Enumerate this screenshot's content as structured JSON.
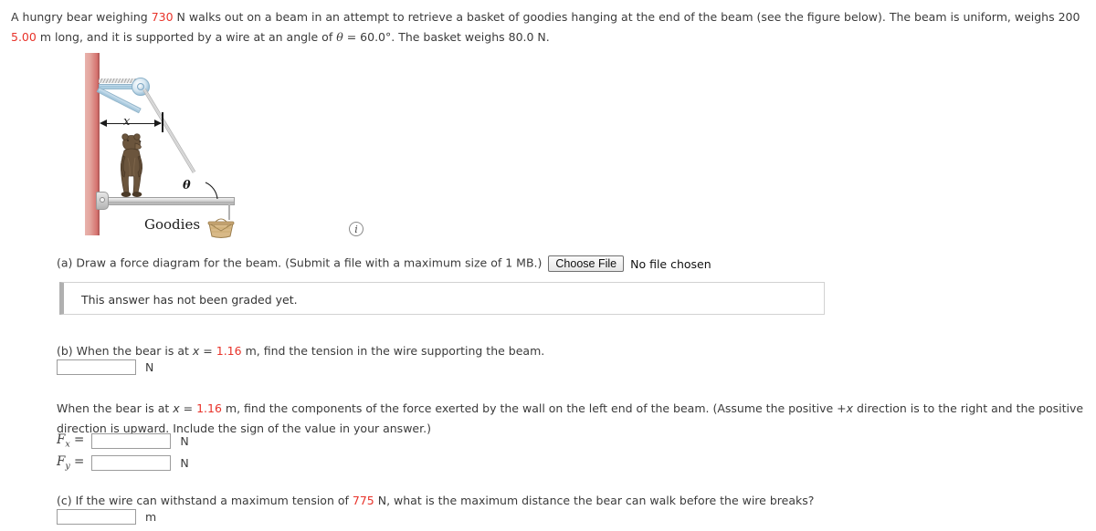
{
  "problem": {
    "line1_a": "A hungry bear weighing ",
    "weight_bear": "730",
    "line1_b": " N walks out on a beam in an attempt to retrieve a basket of goodies hanging at the end of the beam (see the figure below). The beam is uniform, weighs 200",
    "line2_a": " m long, and it is supported by a wire at an angle of ",
    "theta_symbol": "θ",
    "line2_b": " = 60.0°. The basket weighs 80.0 N.",
    "beam_length": "5.00"
  },
  "figure": {
    "x_label": "x",
    "theta_label": "θ",
    "goodies_label": "Goodies",
    "info_icon_glyph": "i",
    "colors": {
      "wall": "#d4706c",
      "beam": "#a9a9a9",
      "bracket": "#9cc2d9",
      "bear": "#6b553d",
      "basket": "#c9a978"
    }
  },
  "part_a": {
    "prompt": "(a) Draw a force diagram for the beam. (Submit a file with a maximum size of 1 MB.)",
    "file_button_label": "Choose File",
    "file_status": "No file chosen",
    "graded_status": "This answer has not been graded yet."
  },
  "part_b": {
    "prompt_a": "(b) When the bear is at ",
    "x_symbol": "x",
    "prompt_eq": " = ",
    "x_value": "1.16",
    "prompt_b": " m, find the tension in the wire supporting the beam.",
    "answer_value": "",
    "answer_unit": "N"
  },
  "components": {
    "prompt_a": "When the bear is at ",
    "x_symbol": "x",
    "prompt_eq": " = ",
    "x_value": "1.16",
    "prompt_b": " m, find the components of the force exerted by the wall on the left end of the beam. (Assume the positive +",
    "plus_x_symbol": "x",
    "prompt_c": " direction is to the right and the positive",
    "prompt_line2": "direction is upward. Include the sign of the value in your answer.)",
    "fx_label": "F",
    "fx_sub": "x",
    "fy_label": "F",
    "fy_sub": "y",
    "equals": "=",
    "fx_value": "",
    "fy_value": "",
    "unit": "N"
  },
  "part_c": {
    "prompt_a": "(c) If the wire can withstand a maximum tension of ",
    "max_tension": "775",
    "prompt_b": " N, what is the maximum distance the bear can walk before the wire breaks?",
    "answer_value": "",
    "answer_unit": "m"
  }
}
